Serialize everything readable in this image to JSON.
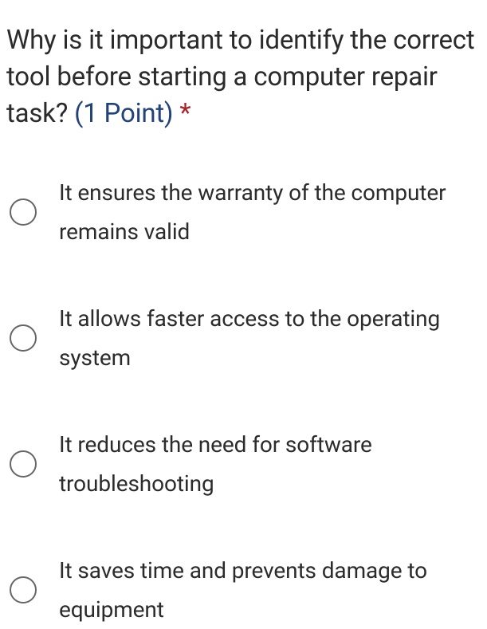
{
  "question": {
    "text": "Why is it important to identify the correct tool before starting a computer repair task?",
    "points_label": "(1 Point)",
    "required_mark": "*"
  },
  "options": [
    {
      "label": "It ensures the warranty of the com­puter remains valid"
    },
    {
      "label": "It allows faster access to the operat­ing system"
    },
    {
      "label": "It reduces the need for software troubleshooting"
    },
    {
      "label": "It saves time and prevents damage to equipment"
    }
  ]
}
